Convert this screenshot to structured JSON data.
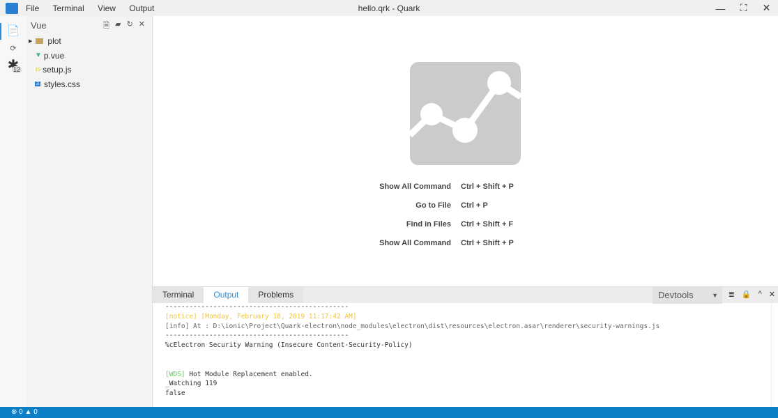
{
  "menu": [
    "File",
    "Terminal",
    "View",
    "Output"
  ],
  "title": "hello.qrk - Quark",
  "activity": {
    "badge": "12"
  },
  "sidebar": {
    "title": "Vue",
    "items": [
      {
        "label": "plot",
        "icon": "folder-icon"
      },
      {
        "label": "p.vue",
        "icon": "vue-icon"
      },
      {
        "label": "setup.js",
        "icon": "js-icon"
      },
      {
        "label": "styles.css",
        "icon": "css-icon"
      }
    ]
  },
  "welcome": [
    {
      "label": "Show All Command",
      "keys": "Ctrl + Shift + P"
    },
    {
      "label": "Go to File",
      "keys": "Ctrl + P"
    },
    {
      "label": "Find in Files",
      "keys": "Ctrl + Shift + F"
    },
    {
      "label": "Show All Command",
      "keys": "Ctrl + Shift + P"
    }
  ],
  "panel": {
    "tabs": [
      "Terminal",
      "Output",
      "Problems"
    ],
    "select": "Devtools"
  },
  "output": {
    "sep": "----------------------------------------------",
    "notice_tag": "[notice]",
    "notice_date": "[Monday, February 18, 2019 11:17:42 AM]",
    "info": "[info] At : D:\\ionic\\Project\\Quark-electron\\node_modules\\electron\\dist\\resources\\electron.asar\\renderer\\security-warnings.js",
    "warning": "%cElectron Security Warning (Insecure Content-Security-Policy)",
    "wds_tag": "[WDS]",
    "wds": " Hot Module Replacement enabled.",
    "watching": "_Watching 119",
    "false": "false"
  },
  "status": {
    "errors": "0",
    "warnings": "0"
  }
}
